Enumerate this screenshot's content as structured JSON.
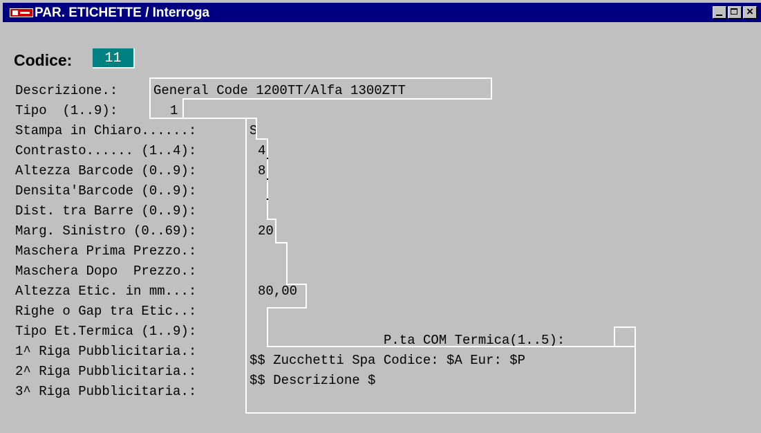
{
  "window": {
    "title": "PAR. ETICHETTE / Interroga",
    "minimize_glyph": "_",
    "maximize_glyph": "□",
    "close_glyph": "×"
  },
  "codice": {
    "label": "Codice:",
    "value": "11"
  },
  "fields": [
    {
      "label": "Descrizione.:",
      "value": "General Code 1200TT/Alfa 1300ZTT"
    },
    {
      "label": "Tipo  (1..9):",
      "value": "1"
    },
    {
      "label": "Stampa in Chiaro......:",
      "value": "S"
    },
    {
      "label": "Contrasto...... (1..4):",
      "value": "4"
    },
    {
      "label": "Altezza Barcode (0..9):",
      "value": "8"
    },
    {
      "label": "Densita'Barcode (0..9):",
      "value": ""
    },
    {
      "label": "Dist. tra Barre (0..9):",
      "value": ""
    },
    {
      "label": "Marg. Sinistro (0..69):",
      "value": "20"
    },
    {
      "label": "Maschera Prima Prezzo.:",
      "value": ""
    },
    {
      "label": "Maschera Dopo  Prezzo.:",
      "value": ""
    },
    {
      "label": "Altezza Etic. in mm...:",
      "value": "80,00"
    },
    {
      "label": "Righe o Gap tra Etic..:",
      "value": ""
    },
    {
      "label": "Tipo Et.Termica (1..9):",
      "value": "",
      "extra_label": "P.ta COM Termica(1..5):",
      "extra_value": ""
    },
    {
      "label": "1^ Riga Pubblicitaria.:",
      "value": "$$ Zucchetti Spa Codice: $A Eur: $P"
    },
    {
      "label": "2^ Riga Pubblicitaria.:",
      "value": "$$ Descrizione $"
    },
    {
      "label": "3^ Riga Pubblicitaria.:",
      "value": ""
    }
  ],
  "colors": {
    "title_bar": "#000080",
    "window_bg": "#c0c0c0",
    "codice_bg": "#008080",
    "field_line": "#ffffff"
  }
}
